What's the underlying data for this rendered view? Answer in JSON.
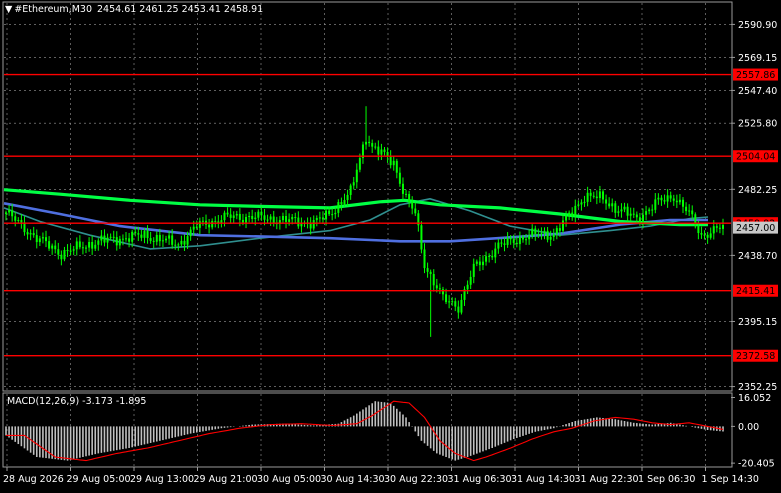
{
  "header": {
    "symbol_timeframe": "#Ethereum,M30",
    "ohlc": "2454.61 2461.25 2453.41 2458.91"
  },
  "macd_label": "MACD(12,26,9) -3.173 -1.895",
  "price_axis": {
    "min": 2350,
    "max": 2605,
    "ticks": [
      "2590.90",
      "2569.15",
      "2547.40",
      "2525.80",
      "2482.25",
      "2438.70",
      "2395.15",
      "2352.25"
    ]
  },
  "levels": [
    {
      "price": 2557.86,
      "label": "2557.86"
    },
    {
      "price": 2504.04,
      "label": "2504.04"
    },
    {
      "price": 2459.92,
      "label": "2459.92"
    },
    {
      "price": 2415.41,
      "label": "2415.41"
    },
    {
      "price": 2372.58,
      "label": "2372.58"
    }
  ],
  "current_price": {
    "price": 2457.0,
    "label": "2457.00"
  },
  "macd_axis": {
    "min": -22,
    "max": 18,
    "ticks": [
      {
        "value": 16.052,
        "label": "16.052"
      },
      {
        "value": 0.0,
        "label": "0.00"
      },
      {
        "value": -20.405,
        "label": "-20.405"
      }
    ]
  },
  "time_axis": [
    "28 Aug 2026",
    "29 Aug 05:00",
    "29 Aug 13:00",
    "29 Aug 21:00",
    "30 Aug 05:00",
    "30 Aug 14:30",
    "30 Aug 22:30",
    "31 Aug 06:30",
    "31 Aug 14:30",
    "31 Aug 22:30",
    "1 Sep 06:30",
    "1 Sep 14:30"
  ],
  "colors": {
    "background": "#000000",
    "grid": "#9a9a9a",
    "candles": "#00ff00",
    "level_line": "#ff0000",
    "level_label_bg": "#ff0000",
    "ma_fast": "#00ff44",
    "ma_blue": "#4f6fe0",
    "ma_teal": "#2f8f8f",
    "macd_hist": "#c0c0c0",
    "macd_signal": "#ff0000"
  },
  "icons": {
    "dropdown": "triangle-down-icon"
  }
}
